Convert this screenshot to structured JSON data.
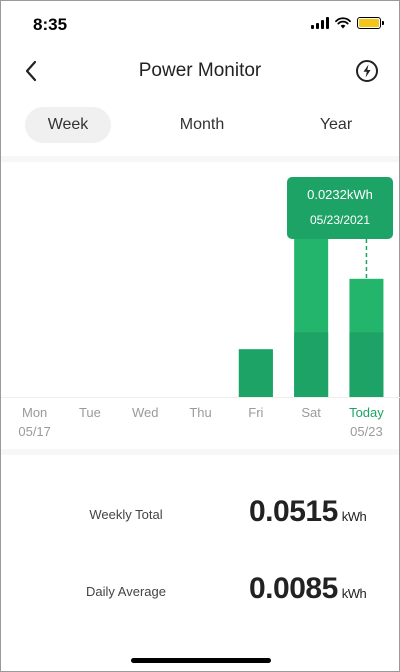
{
  "status_bar": {
    "time": "8:35",
    "signal_icon": "cellular-signal-icon",
    "wifi_icon": "wifi-icon",
    "battery_icon": "battery-icon",
    "battery_color": "#f5c518"
  },
  "header": {
    "title": "Power Monitor",
    "back_icon": "chevron-left-icon",
    "power_icon": "lightning-circle-icon"
  },
  "tabs": [
    {
      "label": "Week",
      "active": true
    },
    {
      "label": "Month",
      "active": false
    },
    {
      "label": "Year",
      "active": false
    }
  ],
  "chart_data": {
    "type": "bar",
    "categories": [
      "Mon",
      "Tue",
      "Wed",
      "Thu",
      "Fri",
      "Sat",
      "Today"
    ],
    "dates": [
      "05/17",
      "",
      "",
      "",
      "",
      "",
      "05/23"
    ],
    "values": [
      0,
      0,
      0,
      0,
      0.0067,
      0.0223,
      0.0166
    ],
    "ylim": [
      0,
      0.033
    ],
    "highlight": {
      "index": 6,
      "value_label": "0.0232kWh",
      "date_label": "05/23/2021"
    },
    "bar_color": "#22b56b",
    "bar_color_dark": "#1ea366",
    "today_color": "#1ea366"
  },
  "stats": {
    "weekly_total": {
      "label": "Weekly Total",
      "value": "0.0515",
      "unit": "kWh"
    },
    "daily_average": {
      "label": "Daily Average",
      "value": "0.0085",
      "unit": "kWh"
    }
  }
}
